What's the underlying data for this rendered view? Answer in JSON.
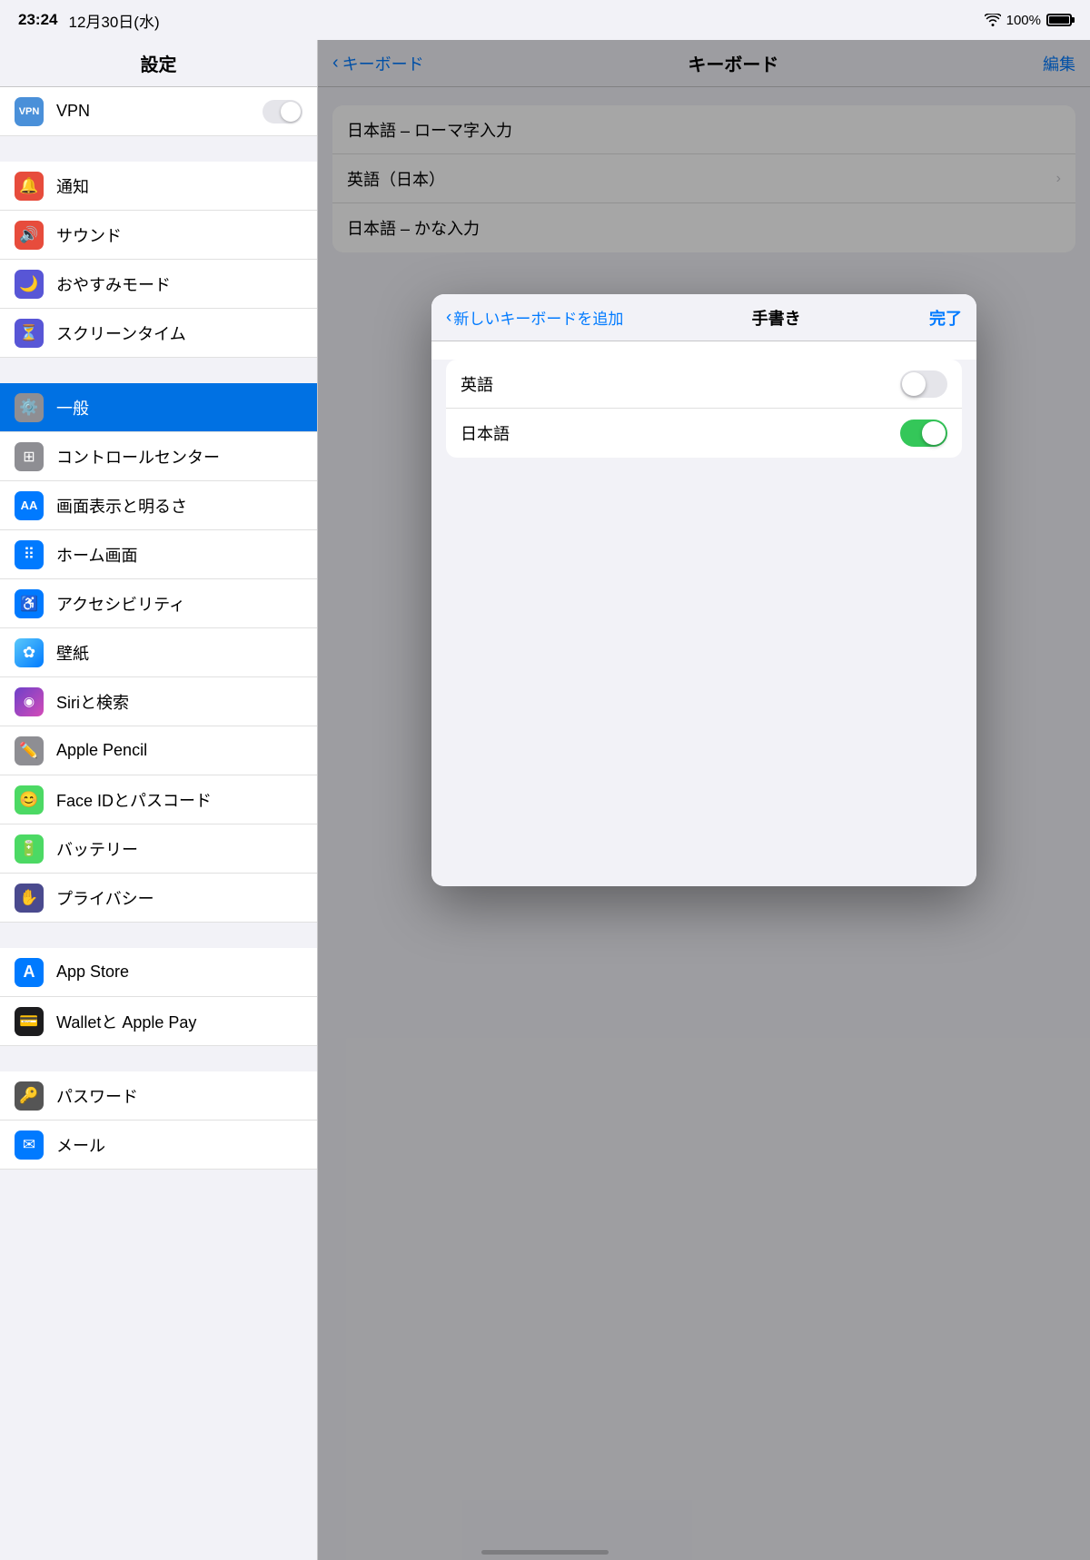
{
  "statusBar": {
    "time": "23:24",
    "date": "12月30日(水)",
    "battery": "100%"
  },
  "leftPanel": {
    "title": "設定",
    "items": [
      {
        "id": "vpn",
        "label": "VPN",
        "iconClass": "icon-vpn",
        "iconText": "VPN",
        "hasToggle": true,
        "groupStart": false
      },
      {
        "id": "notification",
        "label": "通知",
        "iconClass": "icon-notification",
        "iconText": "🔔",
        "hasToggle": false,
        "groupStart": true
      },
      {
        "id": "sound",
        "label": "サウンド",
        "iconClass": "icon-sound",
        "iconText": "🔊",
        "hasToggle": false,
        "groupStart": false
      },
      {
        "id": "donotdisturb",
        "label": "おやすみモード",
        "iconClass": "icon-donotdisturb",
        "iconText": "🌙",
        "hasToggle": false,
        "groupStart": false
      },
      {
        "id": "screentime",
        "label": "スクリーンタイム",
        "iconClass": "icon-screentime",
        "iconText": "⏳",
        "hasToggle": false,
        "groupStart": false
      },
      {
        "id": "general",
        "label": "一般",
        "iconClass": "icon-general",
        "iconText": "⚙️",
        "hasToggle": false,
        "groupStart": true,
        "selected": true
      },
      {
        "id": "control",
        "label": "コントロールセンター",
        "iconClass": "icon-control",
        "iconText": "🔘",
        "hasToggle": false,
        "groupStart": false
      },
      {
        "id": "display",
        "label": "画面表示と明るさ",
        "iconClass": "icon-display",
        "iconText": "AA",
        "hasToggle": false,
        "groupStart": false
      },
      {
        "id": "home",
        "label": "ホーム画面",
        "iconClass": "icon-home",
        "iconText": "⠿",
        "hasToggle": false,
        "groupStart": false
      },
      {
        "id": "accessibility",
        "label": "アクセシビリティ",
        "iconClass": "icon-accessibility",
        "iconText": "♿",
        "hasToggle": false,
        "groupStart": false
      },
      {
        "id": "wallpaper",
        "label": "壁紙",
        "iconClass": "icon-wallpaper",
        "iconText": "✿",
        "hasToggle": false,
        "groupStart": false
      },
      {
        "id": "siri",
        "label": "Siriと検索",
        "iconClass": "icon-siri",
        "iconText": "◉",
        "hasToggle": false,
        "groupStart": false
      },
      {
        "id": "applepencil",
        "label": "Apple Pencil",
        "iconClass": "icon-applepencil",
        "iconText": "✏️",
        "hasToggle": false,
        "groupStart": false
      },
      {
        "id": "faceid",
        "label": "Face IDとパスコード",
        "iconClass": "icon-faceid",
        "iconText": "😊",
        "hasToggle": false,
        "groupStart": false
      },
      {
        "id": "battery",
        "label": "バッテリー",
        "iconClass": "icon-battery",
        "iconText": "🔋",
        "hasToggle": false,
        "groupStart": false
      },
      {
        "id": "privacy",
        "label": "プライバシー",
        "iconClass": "icon-privacy",
        "iconText": "✋",
        "hasToggle": false,
        "groupStart": false
      },
      {
        "id": "appstore",
        "label": "App Store",
        "iconClass": "icon-appstore",
        "iconText": "A",
        "hasToggle": false,
        "groupStart": true
      },
      {
        "id": "wallet",
        "label": "Walletと Apple Pay",
        "iconClass": "icon-wallet",
        "iconText": "💳",
        "hasToggle": false,
        "groupStart": false
      },
      {
        "id": "password",
        "label": "パスワード",
        "iconClass": "icon-password",
        "iconText": "🔑",
        "hasToggle": false,
        "groupStart": true
      },
      {
        "id": "mail",
        "label": "メール",
        "iconClass": "icon-mail",
        "iconText": "✉",
        "hasToggle": false,
        "groupStart": false
      }
    ]
  },
  "rightPanel": {
    "backLabel": "キーボード",
    "title": "キーボード",
    "editLabel": "編集",
    "keyboards": [
      {
        "label": "日本語 – ローマ字入力",
        "hasChevron": false
      },
      {
        "label": "英語（日本）",
        "hasChevron": true
      },
      {
        "label": "日本語 – かな入力",
        "hasChevron": false
      }
    ]
  },
  "modal": {
    "backLabel": "新しいキーボードを追加",
    "title": "手書き",
    "doneLabel": "完了",
    "languages": [
      {
        "label": "英語",
        "enabled": false
      },
      {
        "label": "日本語",
        "enabled": true
      }
    ]
  }
}
